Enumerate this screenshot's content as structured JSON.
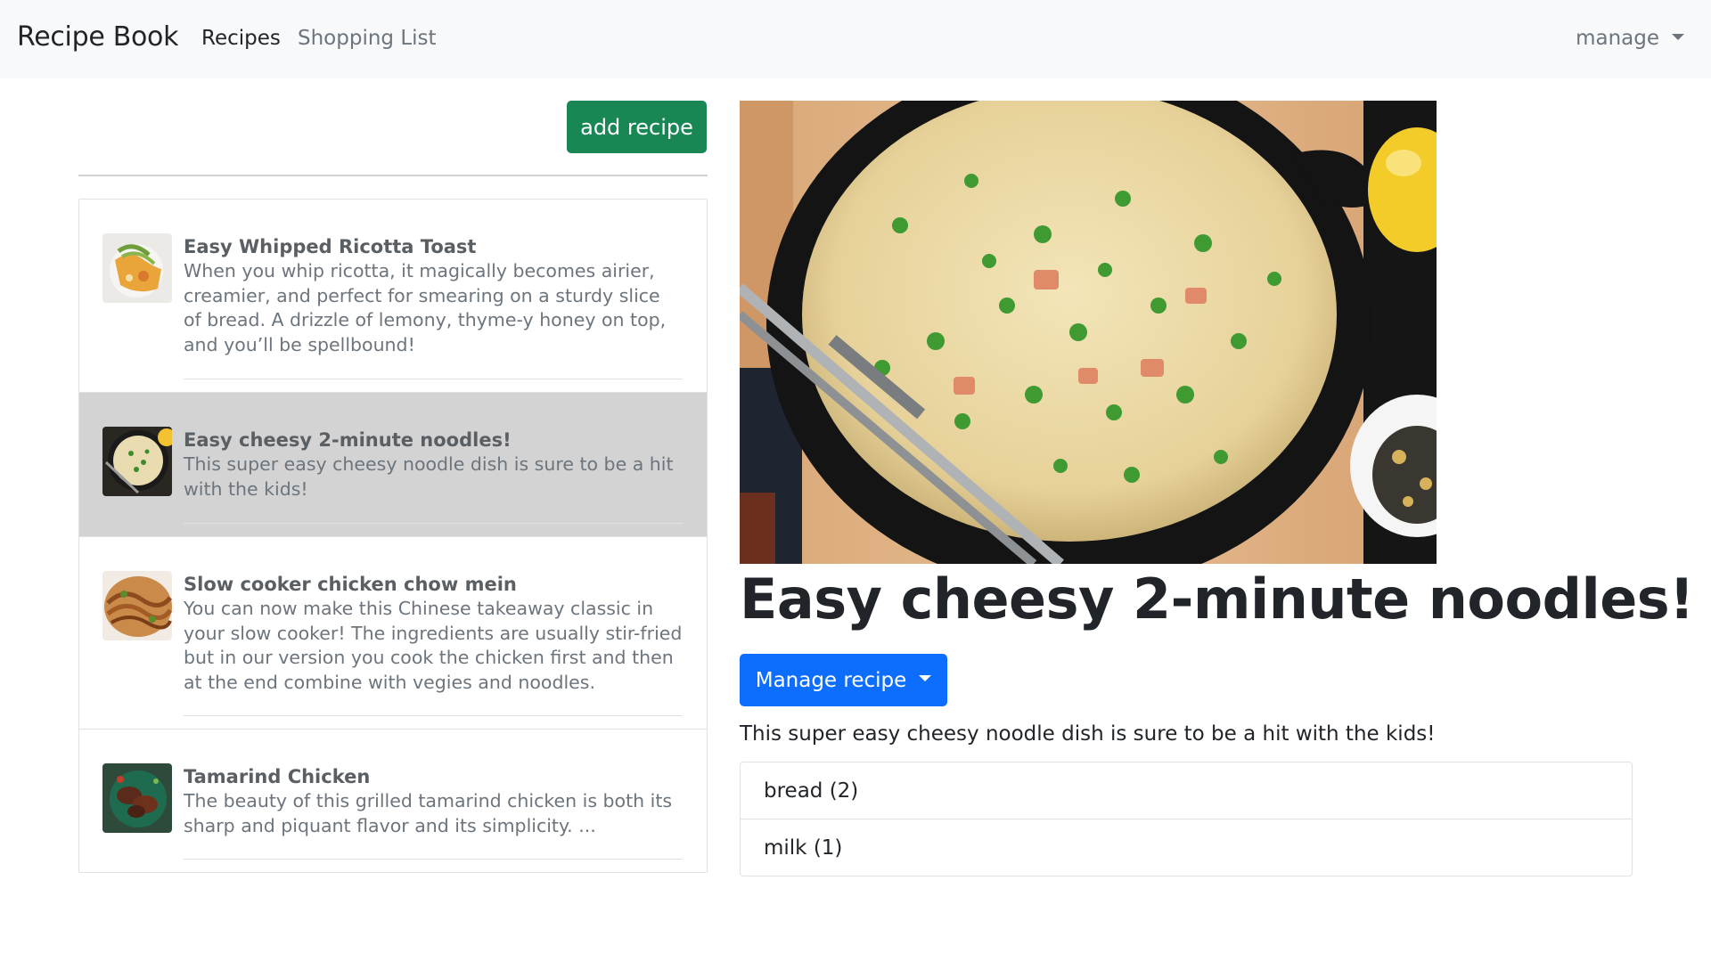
{
  "navbar": {
    "brand": "Recipe Book",
    "links": [
      {
        "label": "Recipes",
        "active": true
      },
      {
        "label": "Shopping List",
        "active": false
      }
    ],
    "manage_label": "manage"
  },
  "sidebar": {
    "add_button_label": "add recipe",
    "recipes": [
      {
        "title": "Easy Whipped Ricotta Toast",
        "description": "When you whip ricotta, it magically becomes airier, creamier, and perfect for smearing on a sturdy slice of bread. A drizzle of lemony, thyme-y honey on top, and you’ll be spellbound!",
        "active": false
      },
      {
        "title": "Easy cheesy 2-minute noodles!",
        "description": "This super easy cheesy noodle dish is sure to be a hit with the kids!",
        "active": true
      },
      {
        "title": "Slow cooker chicken chow mein",
        "description": "You can now make this Chinese takeaway classic in your slow cooker! The ingredients are usually stir-fried but in our version you cook the chicken first and then at the end combine with vegies and noodles.",
        "active": false
      },
      {
        "title": "Tamarind Chicken",
        "description": "The beauty of this grilled tamarind chicken is both its sharp and piquant flavor and its simplicity. ...",
        "active": false
      }
    ]
  },
  "detail": {
    "title": "Easy cheesy 2-minute noodles!",
    "manage_button_label": "Manage recipe",
    "description": "This super easy cheesy noodle dish is sure to be a hit with the kids!",
    "ingredients": [
      "bread (2)",
      "milk (1)"
    ]
  },
  "colors": {
    "navbar_bg": "#f8f9fa",
    "add_button": "#198754",
    "manage_button": "#0d6efd",
    "active_item_bg": "#d3d3d3"
  }
}
